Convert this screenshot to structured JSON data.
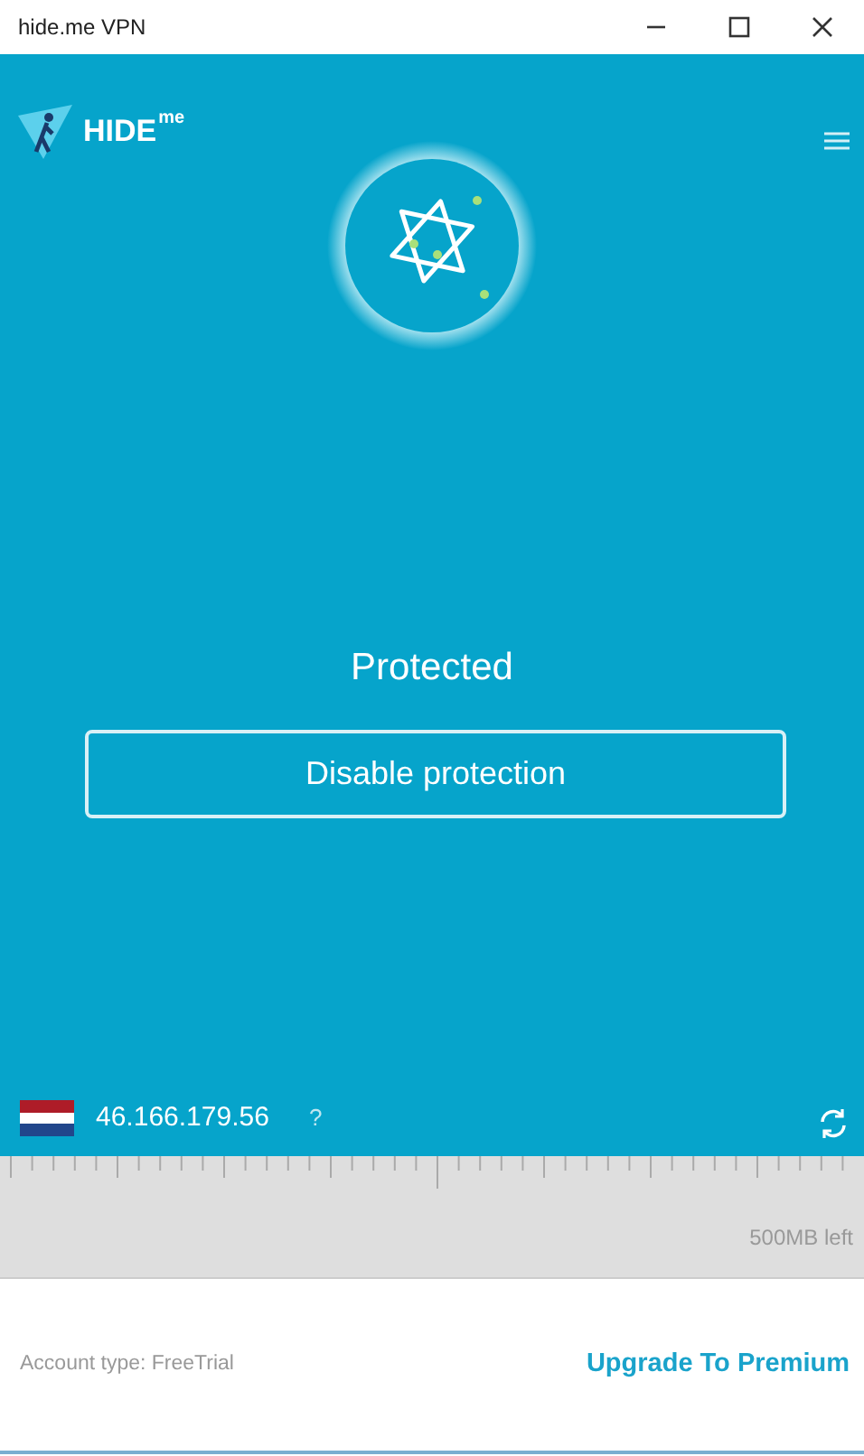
{
  "window": {
    "title": "hide.me VPN"
  },
  "logo": {
    "text": "HIDE",
    "suffix": "me"
  },
  "status": {
    "label": "Protected"
  },
  "action_button": {
    "label": "Disable protection"
  },
  "connection": {
    "ip": "46.166.179.56",
    "help": "?"
  },
  "data_usage": {
    "remaining": "500MB left"
  },
  "footer": {
    "account": "Account type: FreeTrial",
    "upgrade_link": "Upgrade To Premium"
  }
}
